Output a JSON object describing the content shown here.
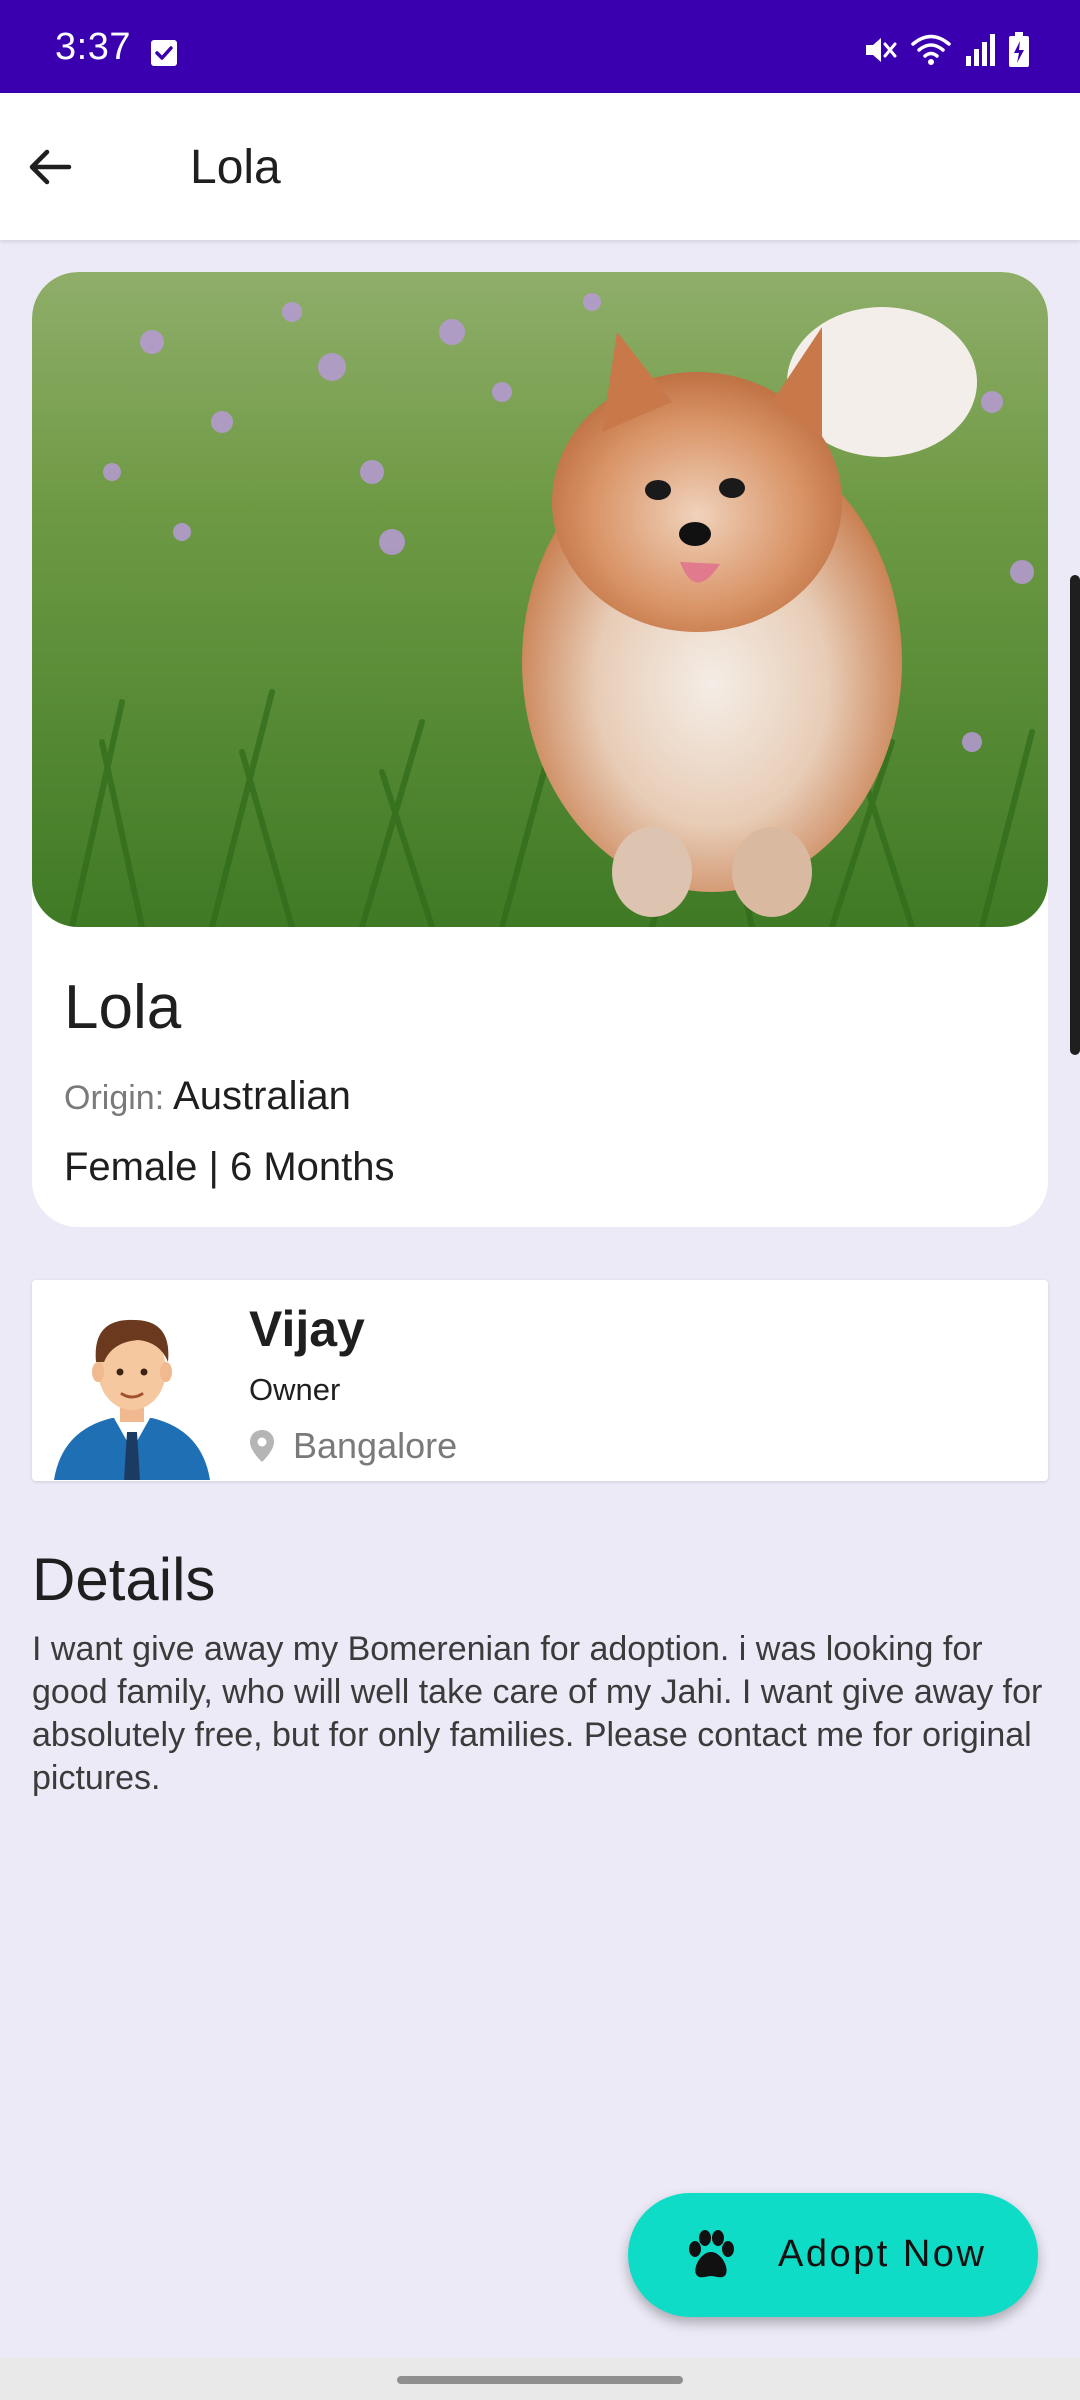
{
  "status_bar": {
    "time": "3:37",
    "background": "#3a00b0",
    "icons": [
      "task-check-icon",
      "mute-icon",
      "wifi-icon",
      "signal-icon",
      "battery-charging-icon"
    ]
  },
  "app_bar": {
    "title": "Lola",
    "back_icon": "arrow-back-icon"
  },
  "pet": {
    "name": "Lola",
    "origin_label": "Origin:",
    "origin_value": "Australian",
    "gender_age": "Female | 6 Months"
  },
  "owner": {
    "name": "Vijay",
    "role": "Owner",
    "location": "Bangalore"
  },
  "details": {
    "title": "Details",
    "body": "I want give away my Bomerenian for adoption. i was looking for good family, who will well take care of my Jahi. I want give away for absolutely free, but for only families. Please contact me for original pictures."
  },
  "fab": {
    "label": "Adopt Now",
    "icon": "paw-icon",
    "color": "#0edcc6"
  },
  "colors": {
    "page_background": "#ebeaf6",
    "card": "#ffffff"
  }
}
